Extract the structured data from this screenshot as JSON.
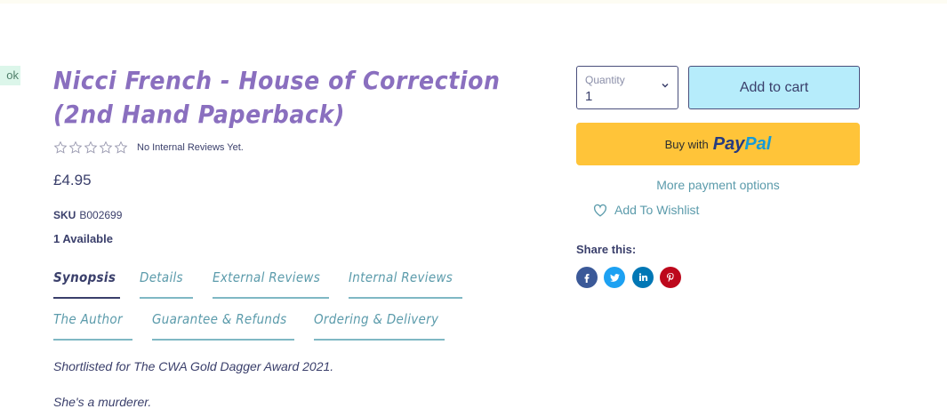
{
  "edge_badge": "ok",
  "product": {
    "title": "Nicci French - House of Correction (2nd Hand Paperback)",
    "reviews_text": "No Internal Reviews Yet.",
    "rating_stars": 0,
    "price": "£4.95",
    "sku_label": "SKU",
    "sku_value": "B002699",
    "availability": "1 Available"
  },
  "tabs": [
    {
      "label": "Synopsis",
      "active": true
    },
    {
      "label": "Details",
      "active": false
    },
    {
      "label": "External Reviews",
      "active": false
    },
    {
      "label": "Internal Reviews",
      "active": false
    },
    {
      "label": "The Author",
      "active": false
    },
    {
      "label": "Guarantee & Refunds",
      "active": false
    },
    {
      "label": "Ordering & Delivery",
      "active": false
    }
  ],
  "synopsis": {
    "line1": "Shortlisted for The CWA Gold Dagger Award 2021.",
    "line2": "She's a murderer."
  },
  "purchase": {
    "quantity_label": "Quantity",
    "quantity_value": "1",
    "add_to_cart": "Add to cart",
    "paypal_buy_with": "Buy with",
    "paypal_logo_a": "Pay",
    "paypal_logo_b": "Pal",
    "more_payment_options": "More payment options",
    "wishlist_label": "Add To Wishlist"
  },
  "share": {
    "title": "Share this:",
    "networks": [
      {
        "name": "facebook",
        "color": "#3b5998"
      },
      {
        "name": "twitter",
        "color": "#1da1f2"
      },
      {
        "name": "linkedin",
        "color": "#0077b5"
      },
      {
        "name": "pinterest",
        "color": "#bd081c"
      }
    ]
  },
  "colors": {
    "title": "#8a6fbf",
    "text": "#3a3f6b",
    "accent_teal": "#5b9bab",
    "add_to_cart_bg": "#b6ecfb",
    "paypal_bg": "#ffc439"
  }
}
